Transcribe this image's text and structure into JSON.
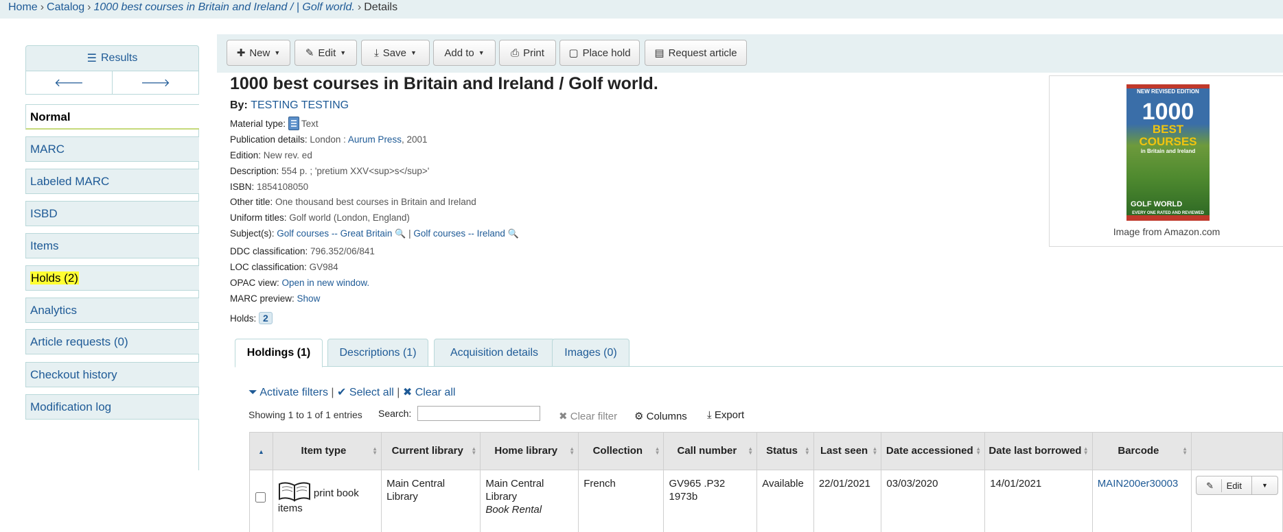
{
  "breadcrumb": {
    "home": "Home",
    "catalog": "Catalog",
    "record": "1000 best courses in Britain and Ireland / | Golf world.",
    "current": "Details",
    "sep": "›"
  },
  "sidebar": {
    "results_label": "Results",
    "items": [
      {
        "label": "Normal"
      },
      {
        "label": "MARC"
      },
      {
        "label": "Labeled MARC"
      },
      {
        "label": "ISBD"
      },
      {
        "label": "Items"
      },
      {
        "label": "Holds (2)"
      },
      {
        "label": "Analytics"
      },
      {
        "label": "Article requests (0)"
      },
      {
        "label": "Checkout history"
      },
      {
        "label": "Modification log"
      }
    ]
  },
  "toolbar": {
    "new": "New",
    "edit": "Edit",
    "save": "Save",
    "add_to": "Add to",
    "print": "Print",
    "place_hold": "Place hold",
    "request_article": "Request article"
  },
  "record": {
    "title": "1000 best courses in Britain and Ireland / Golf world.",
    "by_label": "By:",
    "author": "TESTING TESTING",
    "fields": {
      "material_type": {
        "label": "Material type:",
        "value": "Text"
      },
      "publication": {
        "label": "Publication details:",
        "place": "London :",
        "publisher": "Aurum Press",
        "year": ", 2001"
      },
      "edition": {
        "label": "Edition:",
        "value": "New rev. ed"
      },
      "description": {
        "label": "Description:",
        "value": "554 p. ; 'pretium XXV<sup>s</sup>'"
      },
      "isbn": {
        "label": "ISBN:",
        "value": "1854108050"
      },
      "other_title": {
        "label": "Other title:",
        "value": "One thousand best courses in Britain and Ireland"
      },
      "uniform_titles": {
        "label": "Uniform titles:",
        "value": "Golf world (London, England)"
      },
      "subjects": {
        "label": "Subject(s):",
        "subject1": "Golf courses -- Great Britain",
        "sep": " | ",
        "subject2": "Golf courses -- Ireland"
      },
      "ddc": {
        "label": "DDC classification:",
        "value": "796.352/06/841"
      },
      "loc": {
        "label": "LOC classification:",
        "value": "GV984"
      },
      "opac": {
        "label": "OPAC view:",
        "value": "Open in new window."
      },
      "marc_preview": {
        "label": "MARC preview:",
        "value": "Show"
      },
      "holds": {
        "label": "Holds:",
        "value": "2"
      }
    }
  },
  "cover": {
    "caption": "Image from Amazon.com",
    "top_banner": "NEW REVISED EDITION",
    "number": "1000",
    "words": "BEST COURSES",
    "sub": "in Britain and Ireland",
    "logo": "GOLF WORLD",
    "bottom_banner": "EVERY ONE RATED AND REVIEWED"
  },
  "tabs": [
    {
      "label": "Holdings (1)"
    },
    {
      "label": "Descriptions (1)"
    },
    {
      "label": "Acquisition details"
    },
    {
      "label": "Images (0)"
    }
  ],
  "holdings": {
    "activate_filters": "Activate filters",
    "select_all": "Select all",
    "clear_all": "Clear all",
    "sep": "|",
    "showing": "Showing 1 to 1 of 1 entries",
    "search_label": "Search:",
    "search_value": "",
    "clear_filter": "Clear filter",
    "columns": "Columns",
    "export": "Export",
    "headers": [
      "Item type",
      "Current library",
      "Home library",
      "Collection",
      "Call number",
      "Status",
      "Last seen",
      "Date accessioned",
      "Date last borrowed",
      "Barcode"
    ],
    "row": {
      "item_type": "print book items",
      "current_library": "Main Central Library",
      "home_library": "Main Central Library",
      "home_library_note": "Book Rental",
      "collection": "French",
      "call_number": "GV965 .P32 1973b",
      "status": "Available",
      "last_seen": "22/01/2021",
      "date_accessioned": "03/03/2020",
      "date_last_borrowed": "14/01/2021",
      "barcode": "MAIN200er30003",
      "edit": "Edit"
    }
  }
}
